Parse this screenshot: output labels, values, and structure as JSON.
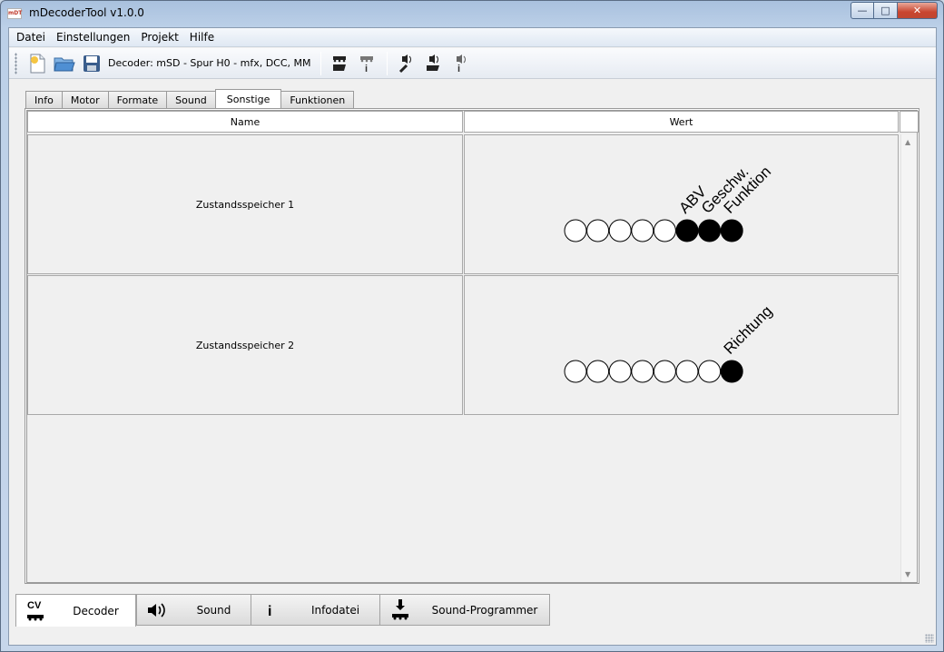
{
  "window": {
    "title": "mDecoderTool v1.0.0",
    "app_icon_text": "mDT",
    "controls": [
      "minimize",
      "maximize",
      "close"
    ]
  },
  "menu": {
    "items": [
      "Datei",
      "Einstellungen",
      "Projekt",
      "Hilfe"
    ]
  },
  "toolbar": {
    "decoder_label": "Decoder: mSD - Spur H0 - mfx, DCC, MM"
  },
  "tabs": {
    "items": [
      "Info",
      "Motor",
      "Formate",
      "Sound",
      "Sonstige",
      "Funktionen"
    ],
    "active": "Sonstige"
  },
  "table": {
    "headers": {
      "name": "Name",
      "value": "Wert"
    },
    "rows": [
      {
        "name": "Zustandsspeicher 1",
        "bits": [
          0,
          0,
          0,
          0,
          0,
          1,
          1,
          1
        ],
        "labels": [
          "ABV",
          "Geschw.",
          "Funktion"
        ]
      },
      {
        "name": "Zustandsspeicher 2",
        "bits": [
          0,
          0,
          0,
          0,
          0,
          0,
          0,
          1
        ],
        "labels": [
          "Richtung"
        ]
      }
    ]
  },
  "bottom_tabs": {
    "items": [
      {
        "icon_text": "CV",
        "label": "Decoder",
        "icon": "cv-locomotive-icon"
      },
      {
        "label": "Sound",
        "icon": "speaker-icon"
      },
      {
        "label": "Infodatei",
        "icon": "info-icon"
      },
      {
        "label": "Sound-Programmer",
        "icon": "download-locomotive-icon"
      }
    ],
    "active": "Decoder"
  },
  "colors": {
    "bit_on": "#000000",
    "bit_off": "#ffffff",
    "close_button": "#c9452f"
  }
}
